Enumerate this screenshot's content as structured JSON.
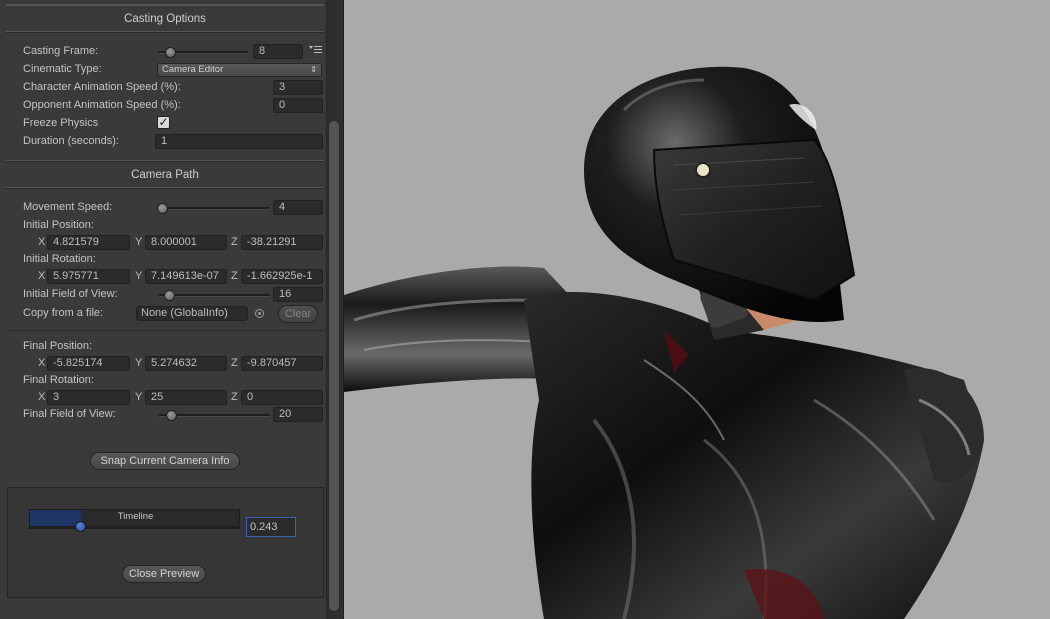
{
  "casting_options": {
    "title": "Casting Options",
    "casting_frame": {
      "label": "Casting Frame:",
      "value": "8"
    },
    "cinematic_type": {
      "label": "Cinematic Type:",
      "value": "Camera Editor"
    },
    "character_anim_speed": {
      "label": "Character Animation Speed (%):",
      "value": "3"
    },
    "opponent_anim_speed": {
      "label": "Opponent Animation Speed (%):",
      "value": "0"
    },
    "freeze_physics": {
      "label": "Freeze Physics",
      "checked": true
    },
    "duration": {
      "label": "Duration (seconds):",
      "value": "1"
    }
  },
  "camera_path": {
    "title": "Camera Path",
    "movement_speed": {
      "label": "Movement Speed:",
      "value": "4"
    },
    "initial_position": {
      "label": "Initial Position:",
      "x": "4.821579",
      "y": "8.000001",
      "z": "-38.21291"
    },
    "initial_rotation": {
      "label": "Initial Rotation:",
      "x": "5.975771",
      "y": "7.149613e-07",
      "z": "-1.662925e-1"
    },
    "initial_fov": {
      "label": "Initial Field of View:",
      "value": "16"
    },
    "copy_from_file": {
      "label": "Copy from a file:",
      "value": "None (GlobalInfo)",
      "clear_label": "Clear"
    },
    "final_position": {
      "label": "Final Position:",
      "x": "-5.825174",
      "y": "5.274632",
      "z": "-9.870457"
    },
    "final_rotation": {
      "label": "Final Rotation:",
      "x": "3",
      "y": "25",
      "z": "0"
    },
    "final_fov": {
      "label": "Final Field of View:",
      "value": "20"
    },
    "snap_button": "Snap Current Camera Info"
  },
  "axes": {
    "x": "X",
    "y": "Y",
    "z": "Z"
  },
  "timeline": {
    "label": "Timeline",
    "value": "0.243",
    "fraction": 0.243
  },
  "close_preview": "Close Preview",
  "colors": {
    "panel_bg": "#3a3a3a",
    "field_bg": "#2b2b2b",
    "timeline_fill": "#1f3566",
    "timeline_accent": "#3e5fb8",
    "viewport_bg": "#aaaaaa",
    "suit_black": "#141414",
    "suit_red": "#5a1418",
    "skin": "#c98a6a"
  }
}
